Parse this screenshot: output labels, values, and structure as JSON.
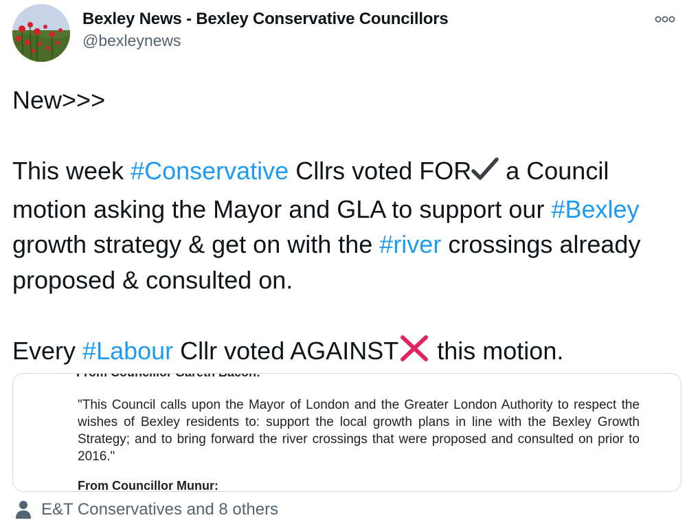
{
  "author": {
    "display_name": "Bexley News - Bexley Conservative Councillors",
    "handle": "@bexleynews",
    "avatar_icon": "poppy-field-avatar"
  },
  "menu": {
    "icon": "more-options-icon"
  },
  "tweet": {
    "line1": "New>>>",
    "p2_a": "This week ",
    "p2_tag1": "#Conservative",
    "p2_b": " Cllrs voted FOR",
    "p2_c": " a Council motion asking the Mayor and GLA to support our ",
    "p2_tag2": "#Bexley",
    "p2_d": " growth strategy & get on with the ",
    "p2_tag3": "#river",
    "p2_e": " crossings already proposed & consulted on.",
    "p3_a": "Every ",
    "p3_tag1": "#Labour",
    "p3_b": " Cllr voted AGAINST",
    "p3_c": " this motion.",
    "check_icon": "checkmark-icon",
    "cross_icon": "cross-mark-icon"
  },
  "media": {
    "cut_top": "From Councillor Gareth Bacon:",
    "quote": "\"This Council calls upon the Mayor of London and the Greater London Authority to respect the wishes of Bexley residents to: support the local growth plans in line with the Bexley Growth Strategy; and to bring forward the river crossings that were proposed and consulted on prior to 2016.\"",
    "cut_bottom": "From Councillor Munur:"
  },
  "footer": {
    "icon": "person-icon",
    "likes_text": "E&T Conservatives and 8 others"
  },
  "colors": {
    "hashtag": "#1d9bf0",
    "secondary_text": "#536471",
    "cross": "#e0245e",
    "check": "#3a3f44"
  }
}
